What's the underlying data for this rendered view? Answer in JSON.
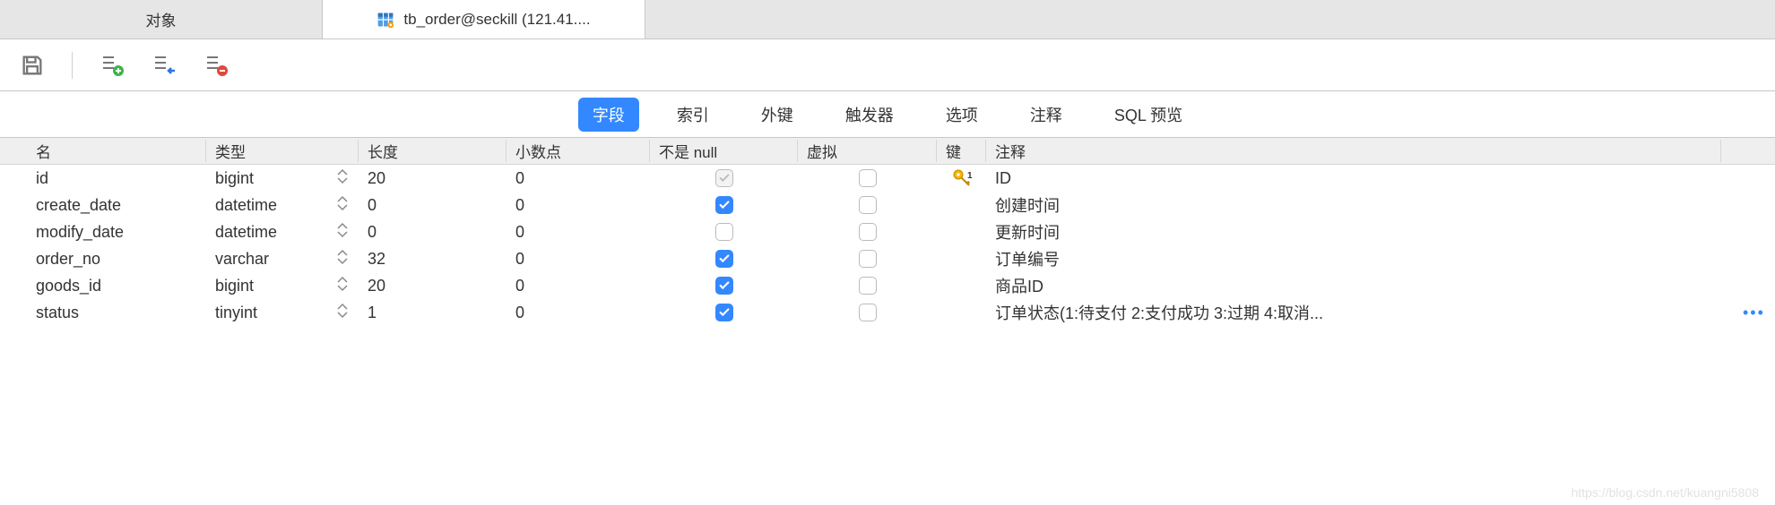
{
  "tabs": [
    {
      "label": "对象",
      "active": false
    },
    {
      "label": "tb_order@seckill (121.41....",
      "active": true
    }
  ],
  "subtabs": {
    "items": [
      "字段",
      "索引",
      "外键",
      "触发器",
      "选项",
      "注释",
      "SQL 预览"
    ],
    "active_index": 0
  },
  "columns_header": {
    "name": "名",
    "type": "类型",
    "length": "长度",
    "decimals": "小数点",
    "not_null": "不是 null",
    "virtual": "虚拟",
    "key": "键",
    "comment": "注释"
  },
  "rows": [
    {
      "name": "id",
      "type": "bigint",
      "length": "20",
      "decimals": "0",
      "not_null": "disabled",
      "virtual": false,
      "key": true,
      "comment": "ID"
    },
    {
      "name": "create_date",
      "type": "datetime",
      "length": "0",
      "decimals": "0",
      "not_null": "on",
      "virtual": false,
      "key": false,
      "comment": "创建时间"
    },
    {
      "name": "modify_date",
      "type": "datetime",
      "length": "0",
      "decimals": "0",
      "not_null": "off",
      "virtual": false,
      "key": false,
      "comment": "更新时间"
    },
    {
      "name": "order_no",
      "type": "varchar",
      "length": "32",
      "decimals": "0",
      "not_null": "on",
      "virtual": false,
      "key": false,
      "comment": "订单编号"
    },
    {
      "name": "goods_id",
      "type": "bigint",
      "length": "20",
      "decimals": "0",
      "not_null": "on",
      "virtual": false,
      "key": false,
      "comment": "商品ID"
    },
    {
      "name": "status",
      "type": "tinyint",
      "length": "1",
      "decimals": "0",
      "not_null": "on",
      "virtual": false,
      "key": false,
      "comment": "订单状态(1:待支付 2:支付成功 3:过期 4:取消...",
      "truncated": true
    }
  ],
  "watermark": "https://blog.csdn.net/kuangni5808"
}
